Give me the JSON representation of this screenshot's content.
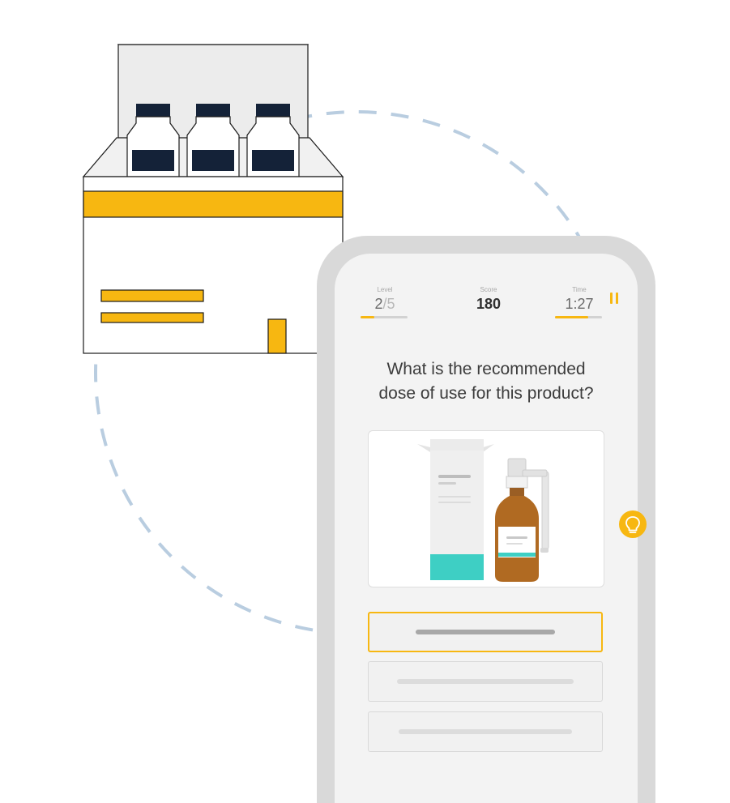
{
  "stats": {
    "level_label": "Level",
    "level_current": "2",
    "level_total": "/5",
    "level_progress": 0.3,
    "score_label": "Score",
    "score_value": "180",
    "time_label": "Time",
    "time_value": "1:27",
    "time_progress": 0.7
  },
  "question": {
    "line1": "What is the recommended",
    "line2": "dose of use for this product?"
  },
  "answers": [
    {
      "selected": true
    },
    {
      "selected": false
    },
    {
      "selected": false
    }
  ],
  "icons": {
    "pause": "pause-icon",
    "hint": "lightbulb-icon"
  },
  "colors": {
    "accent": "#f7b711",
    "navy": "#142238",
    "teal": "#3ecfc4",
    "dashed_circle": "#b9cde0"
  }
}
